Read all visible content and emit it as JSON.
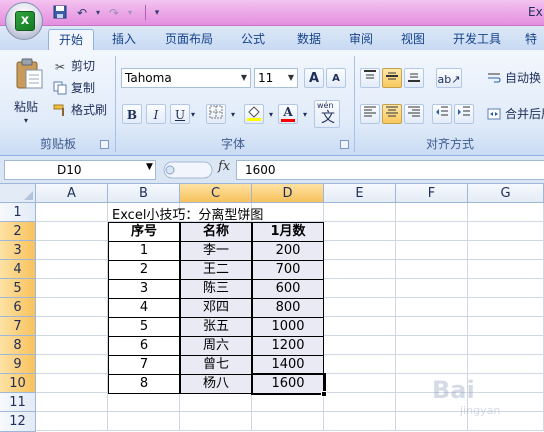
{
  "titlebar": {
    "app_title_fragment": "Ex"
  },
  "tabs": [
    "开始",
    "插入",
    "页面布局",
    "公式",
    "数据",
    "审阅",
    "视图",
    "开发工具",
    "特"
  ],
  "clipboard": {
    "paste_label": "粘贴",
    "cut_label": "剪切",
    "copy_label": "复制",
    "format_painter_label": "格式刷",
    "group_label": "剪贴板"
  },
  "font": {
    "name": "Tahoma",
    "size": "11",
    "group_label": "字体",
    "bold": "B",
    "italic": "I",
    "underline": "U",
    "font_color_glyph": "A",
    "phonetic_top": "wén",
    "phonetic_bottom": "文",
    "grow": "A",
    "shrink": "A",
    "font_color": "#ff0000",
    "fill_color": "#ffff00"
  },
  "alignment": {
    "group_label": "对齐方式",
    "wrap_label": "自动换",
    "merge_label": "合并后居"
  },
  "formula_bar": {
    "name_box": "D10",
    "fx": "fx",
    "value": "1600"
  },
  "columns": [
    "A",
    "B",
    "C",
    "D",
    "E",
    "F",
    "G"
  ],
  "rows": [
    "1",
    "2",
    "3",
    "4",
    "5",
    "6",
    "7",
    "8",
    "9",
    "10",
    "11",
    "12"
  ],
  "sheet": {
    "title": "Excel小技巧：分离型饼图",
    "headers": [
      "序号",
      "名称",
      "1月数"
    ],
    "data": [
      [
        "1",
        "李一",
        "200"
      ],
      [
        "2",
        "王二",
        "700"
      ],
      [
        "3",
        "陈三",
        "600"
      ],
      [
        "4",
        "邓四",
        "800"
      ],
      [
        "5",
        "张五",
        "1000"
      ],
      [
        "6",
        "周六",
        "1200"
      ],
      [
        "7",
        "曾七",
        "1400"
      ],
      [
        "8",
        "杨八",
        "1600"
      ]
    ]
  },
  "watermark": {
    "text": "Bai",
    "sub": "jingyan"
  }
}
